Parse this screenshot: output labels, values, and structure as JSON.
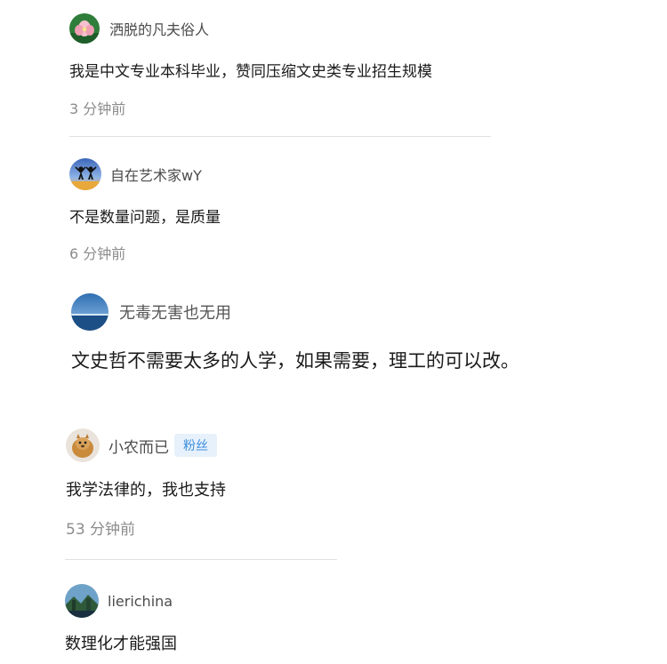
{
  "comments": [
    {
      "username": "洒脱的凡夫俗人",
      "text": "我是中文专业本科毕业，赞同压缩文史类专业招生规模",
      "time": "3 分钟前",
      "avatar_icon": "lotus-avatar"
    },
    {
      "username": "自在艺术家wY",
      "text": "不是数量问题，是质量",
      "time": "6 分钟前",
      "avatar_icon": "silhouette-avatar"
    },
    {
      "username": "无毒无害也无用",
      "text": "文史哲不需要太多的人学，如果需要，理工的可以改。",
      "avatar_icon": "sea-horizon-avatar"
    },
    {
      "username": "小农而已",
      "badge": "粉丝",
      "text": "我学法律的，我也支持",
      "time": "53 分钟前",
      "avatar_icon": "animal-avatar"
    },
    {
      "username": "lierichina",
      "text": "数理化才能强国",
      "avatar_icon": "landscape-avatar"
    }
  ],
  "colors": {
    "username": "#4b4b4b",
    "body": "#1a1a1a",
    "time": "#8c8c8c",
    "divider": "#e1e1e1",
    "badge_bg": "#e7f1fc",
    "badge_text": "#3c8de0"
  }
}
